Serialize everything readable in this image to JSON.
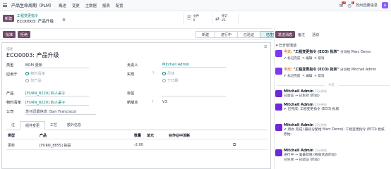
{
  "nav": {
    "app_title": "产品生命周期（PLM）",
    "menu": [
      "概述",
      "变更",
      "主数据",
      "报表",
      "配置"
    ],
    "messages_badge": "15",
    "activities_badge": "1",
    "user_initial": "A",
    "company": "苏州迅鼎信息"
  },
  "control": {
    "new_label": "新建",
    "breadcrumb_parent": "工程变更指令",
    "breadcrumb_current": "ECO0003: 产品升级",
    "gear_icon": "gear-icon"
  },
  "smart": {
    "docs_label": "文件",
    "docs_count": "0",
    "revision_label": "修订",
    "revision_value": "V3"
  },
  "actions": {
    "approve": "批准",
    "reject": "拒绝"
  },
  "stages": [
    "新建",
    "进行中",
    "已验证",
    "已生效"
  ],
  "form": {
    "desc_label": "描述",
    "title": "ECO0003: 产品升级",
    "type_label": "类型",
    "type_value": "BOM 更新",
    "applies_label": "应用于",
    "applies_opt1": "物料清单",
    "applies_opt2": "仅产品",
    "product_label": "产品",
    "product_value": "[FURN_8220] 四人桌子",
    "bom_label": "物料清单",
    "bom_value": "[FURN_8220] 四人桌子",
    "company_label": "公司",
    "company_value": "苏州迅鼎信息 (San Francisco)",
    "owner_label": "负责人",
    "owner_value": "Mitchell Admin",
    "effective_label": "实现",
    "effective_opt1": "尽快",
    "effective_opt2": "于日期",
    "tags_label": "标签",
    "newver_label": "新版本",
    "newver_value": "V3"
  },
  "tabs": [
    "注",
    "组件变更",
    "工艺",
    "额外信息"
  ],
  "table": {
    "headers": [
      "类型",
      "产品",
      "数量",
      "单元",
      "在作业中消耗"
    ],
    "rows": [
      {
        "type": "更新",
        "product": "[FURN_8855] 抽屉",
        "qty": "-2.00",
        "unit": ""
      }
    ]
  },
  "chatter": {
    "send": "发送消息",
    "note": "备注",
    "activity": "活动",
    "planned_header": "已计划活动",
    "activities": [
      {
        "today": "今天:",
        "title": "\"工程变更指令 (ECO) 批核\"",
        "who": "分派给 Marc Demo",
        "done": "标记完成",
        "edit": "编辑",
        "cancel": "取消"
      },
      {
        "today": "今天:",
        "title": "\"工程变更指令 (ECO) 批核\"",
        "who": "分派给 Mitchell Admin",
        "done": "标记完成",
        "edit": "编辑",
        "cancel": "取消"
      }
    ],
    "date_sep": "今天",
    "messages": [
      {
        "name": "Mitchell Admin",
        "time": "12分钟前",
        "text": "已验证 → 已生效 (阶段)"
      },
      {
        "name": "Mitchell Admin",
        "time": "12分钟前",
        "text": "✔ 已完成: 工程变更指令 (ECO) 批核"
      },
      {
        "name": "Mitchell Admin",
        "time": "12分钟前",
        "text": "✔ 待办 完成 (最初分配给 Marc Demo): 工程变更指令 (ECO) 批核"
      },
      {
        "name": "",
        "time": "",
        "text": "原始:"
      },
      {
        "name": "Mitchell Admin",
        "time": "12分钟前",
        "text": "进行中 → 准备就绪 (看板状态阶段)"
      },
      {
        "name": "",
        "time": "",
        "text": "已生效 → 已验证 (阶段)"
      }
    ]
  }
}
